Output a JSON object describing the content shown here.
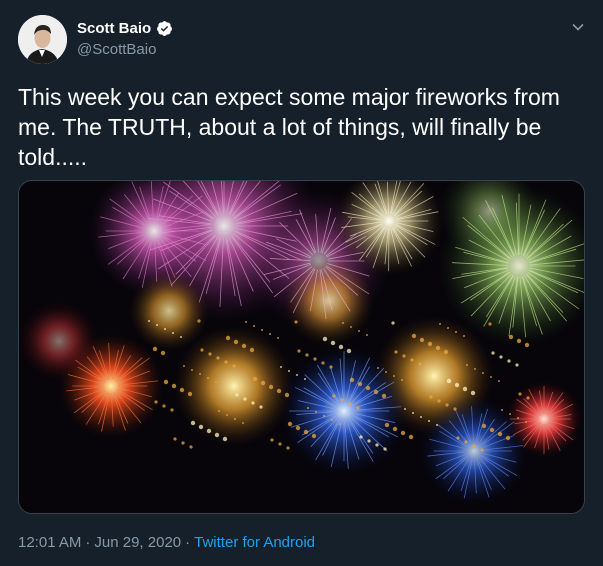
{
  "author": {
    "display_name": "Scott Baio",
    "handle": "@ScottBaio",
    "verified": true,
    "avatar_icon": "profile-photo"
  },
  "tweet": {
    "text": "This week you can expect some major fireworks from me. The TRUTH, about a lot of things, will finally be told.....",
    "media_description_icon": "fireworks-photo"
  },
  "meta": {
    "time": "12:01 AM",
    "separator": "·",
    "date": "Jun 29, 2020",
    "source": "Twitter for Android"
  },
  "colors": {
    "background": "#15202b",
    "text": "#ffffff",
    "muted": "#8899a6",
    "link": "#1da1f2"
  }
}
